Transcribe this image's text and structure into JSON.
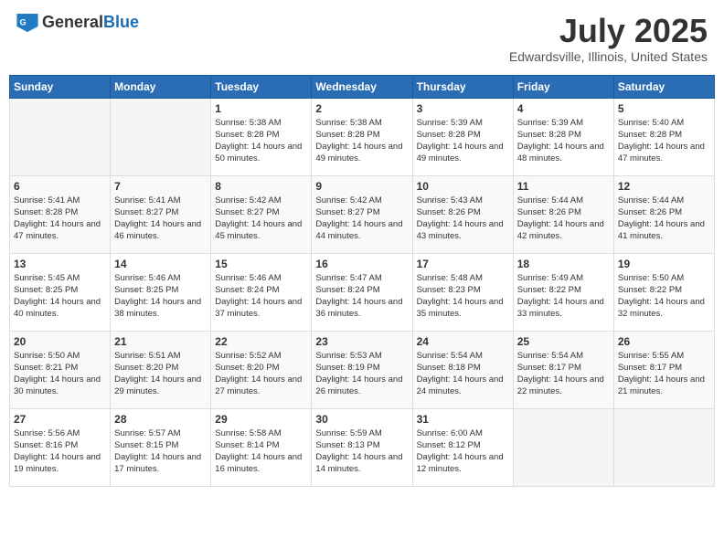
{
  "header": {
    "logo_general": "General",
    "logo_blue": "Blue",
    "month_year": "July 2025",
    "location": "Edwardsville, Illinois, United States"
  },
  "weekdays": [
    "Sunday",
    "Monday",
    "Tuesday",
    "Wednesday",
    "Thursday",
    "Friday",
    "Saturday"
  ],
  "weeks": [
    [
      {
        "day": "",
        "sunrise": "",
        "sunset": "",
        "daylight": ""
      },
      {
        "day": "",
        "sunrise": "",
        "sunset": "",
        "daylight": ""
      },
      {
        "day": "1",
        "sunrise": "Sunrise: 5:38 AM",
        "sunset": "Sunset: 8:28 PM",
        "daylight": "Daylight: 14 hours and 50 minutes."
      },
      {
        "day": "2",
        "sunrise": "Sunrise: 5:38 AM",
        "sunset": "Sunset: 8:28 PM",
        "daylight": "Daylight: 14 hours and 49 minutes."
      },
      {
        "day": "3",
        "sunrise": "Sunrise: 5:39 AM",
        "sunset": "Sunset: 8:28 PM",
        "daylight": "Daylight: 14 hours and 49 minutes."
      },
      {
        "day": "4",
        "sunrise": "Sunrise: 5:39 AM",
        "sunset": "Sunset: 8:28 PM",
        "daylight": "Daylight: 14 hours and 48 minutes."
      },
      {
        "day": "5",
        "sunrise": "Sunrise: 5:40 AM",
        "sunset": "Sunset: 8:28 PM",
        "daylight": "Daylight: 14 hours and 47 minutes."
      }
    ],
    [
      {
        "day": "6",
        "sunrise": "Sunrise: 5:41 AM",
        "sunset": "Sunset: 8:28 PM",
        "daylight": "Daylight: 14 hours and 47 minutes."
      },
      {
        "day": "7",
        "sunrise": "Sunrise: 5:41 AM",
        "sunset": "Sunset: 8:27 PM",
        "daylight": "Daylight: 14 hours and 46 minutes."
      },
      {
        "day": "8",
        "sunrise": "Sunrise: 5:42 AM",
        "sunset": "Sunset: 8:27 PM",
        "daylight": "Daylight: 14 hours and 45 minutes."
      },
      {
        "day": "9",
        "sunrise": "Sunrise: 5:42 AM",
        "sunset": "Sunset: 8:27 PM",
        "daylight": "Daylight: 14 hours and 44 minutes."
      },
      {
        "day": "10",
        "sunrise": "Sunrise: 5:43 AM",
        "sunset": "Sunset: 8:26 PM",
        "daylight": "Daylight: 14 hours and 43 minutes."
      },
      {
        "day": "11",
        "sunrise": "Sunrise: 5:44 AM",
        "sunset": "Sunset: 8:26 PM",
        "daylight": "Daylight: 14 hours and 42 minutes."
      },
      {
        "day": "12",
        "sunrise": "Sunrise: 5:44 AM",
        "sunset": "Sunset: 8:26 PM",
        "daylight": "Daylight: 14 hours and 41 minutes."
      }
    ],
    [
      {
        "day": "13",
        "sunrise": "Sunrise: 5:45 AM",
        "sunset": "Sunset: 8:25 PM",
        "daylight": "Daylight: 14 hours and 40 minutes."
      },
      {
        "day": "14",
        "sunrise": "Sunrise: 5:46 AM",
        "sunset": "Sunset: 8:25 PM",
        "daylight": "Daylight: 14 hours and 38 minutes."
      },
      {
        "day": "15",
        "sunrise": "Sunrise: 5:46 AM",
        "sunset": "Sunset: 8:24 PM",
        "daylight": "Daylight: 14 hours and 37 minutes."
      },
      {
        "day": "16",
        "sunrise": "Sunrise: 5:47 AM",
        "sunset": "Sunset: 8:24 PM",
        "daylight": "Daylight: 14 hours and 36 minutes."
      },
      {
        "day": "17",
        "sunrise": "Sunrise: 5:48 AM",
        "sunset": "Sunset: 8:23 PM",
        "daylight": "Daylight: 14 hours and 35 minutes."
      },
      {
        "day": "18",
        "sunrise": "Sunrise: 5:49 AM",
        "sunset": "Sunset: 8:22 PM",
        "daylight": "Daylight: 14 hours and 33 minutes."
      },
      {
        "day": "19",
        "sunrise": "Sunrise: 5:50 AM",
        "sunset": "Sunset: 8:22 PM",
        "daylight": "Daylight: 14 hours and 32 minutes."
      }
    ],
    [
      {
        "day": "20",
        "sunrise": "Sunrise: 5:50 AM",
        "sunset": "Sunset: 8:21 PM",
        "daylight": "Daylight: 14 hours and 30 minutes."
      },
      {
        "day": "21",
        "sunrise": "Sunrise: 5:51 AM",
        "sunset": "Sunset: 8:20 PM",
        "daylight": "Daylight: 14 hours and 29 minutes."
      },
      {
        "day": "22",
        "sunrise": "Sunrise: 5:52 AM",
        "sunset": "Sunset: 8:20 PM",
        "daylight": "Daylight: 14 hours and 27 minutes."
      },
      {
        "day": "23",
        "sunrise": "Sunrise: 5:53 AM",
        "sunset": "Sunset: 8:19 PM",
        "daylight": "Daylight: 14 hours and 26 minutes."
      },
      {
        "day": "24",
        "sunrise": "Sunrise: 5:54 AM",
        "sunset": "Sunset: 8:18 PM",
        "daylight": "Daylight: 14 hours and 24 minutes."
      },
      {
        "day": "25",
        "sunrise": "Sunrise: 5:54 AM",
        "sunset": "Sunset: 8:17 PM",
        "daylight": "Daylight: 14 hours and 22 minutes."
      },
      {
        "day": "26",
        "sunrise": "Sunrise: 5:55 AM",
        "sunset": "Sunset: 8:17 PM",
        "daylight": "Daylight: 14 hours and 21 minutes."
      }
    ],
    [
      {
        "day": "27",
        "sunrise": "Sunrise: 5:56 AM",
        "sunset": "Sunset: 8:16 PM",
        "daylight": "Daylight: 14 hours and 19 minutes."
      },
      {
        "day": "28",
        "sunrise": "Sunrise: 5:57 AM",
        "sunset": "Sunset: 8:15 PM",
        "daylight": "Daylight: 14 hours and 17 minutes."
      },
      {
        "day": "29",
        "sunrise": "Sunrise: 5:58 AM",
        "sunset": "Sunset: 8:14 PM",
        "daylight": "Daylight: 14 hours and 16 minutes."
      },
      {
        "day": "30",
        "sunrise": "Sunrise: 5:59 AM",
        "sunset": "Sunset: 8:13 PM",
        "daylight": "Daylight: 14 hours and 14 minutes."
      },
      {
        "day": "31",
        "sunrise": "Sunrise: 6:00 AM",
        "sunset": "Sunset: 8:12 PM",
        "daylight": "Daylight: 14 hours and 12 minutes."
      },
      {
        "day": "",
        "sunrise": "",
        "sunset": "",
        "daylight": ""
      },
      {
        "day": "",
        "sunrise": "",
        "sunset": "",
        "daylight": ""
      }
    ]
  ]
}
